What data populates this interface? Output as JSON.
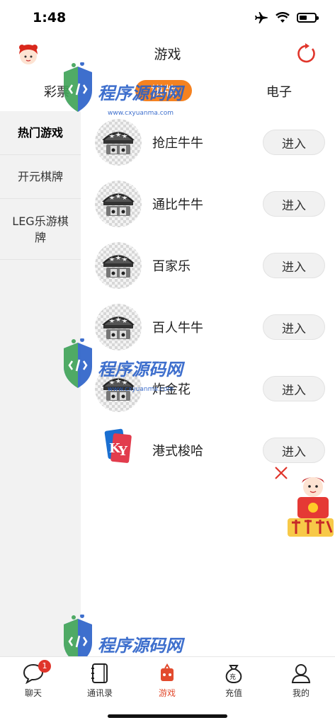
{
  "status": {
    "time": "1:48",
    "battery_level": 0.5
  },
  "nav": {
    "title": "游戏"
  },
  "top_tabs": [
    {
      "label": "彩票"
    },
    {
      "label": "棋牌",
      "active": true
    },
    {
      "label": "电子"
    }
  ],
  "side_menu": [
    {
      "label": "热门游戏",
      "active": true
    },
    {
      "label": "开元棋牌"
    },
    {
      "label": "LEG乐游棋牌"
    }
  ],
  "games": [
    {
      "name": "抢庄牛牛",
      "button": "进入",
      "icon": "casino-icon"
    },
    {
      "name": "通比牛牛",
      "button": "进入",
      "icon": "casino-icon"
    },
    {
      "name": "百家乐",
      "button": "进入",
      "icon": "casino-icon"
    },
    {
      "name": "百人牛牛",
      "button": "进入",
      "icon": "casino-icon"
    },
    {
      "name": "炸金花",
      "button": "进入",
      "icon": "casino-icon"
    },
    {
      "name": "港式梭哈",
      "button": "进入",
      "icon": "ky-cards-icon"
    }
  ],
  "watermark": {
    "text": "程序源码网",
    "url": "www.cxyuanma.com"
  },
  "bottom_tabs": [
    {
      "label": "聊天",
      "icon": "chat-icon",
      "badge": "1"
    },
    {
      "label": "通讯录",
      "icon": "contacts-icon"
    },
    {
      "label": "游戏",
      "icon": "game-icon",
      "active": true
    },
    {
      "label": "充值",
      "icon": "recharge-icon"
    },
    {
      "label": "我的",
      "icon": "profile-icon"
    }
  ],
  "colors": {
    "accent": "#f58220",
    "active_tab": "#e24b2e",
    "badge": "#e0352b",
    "watermark": "#2a60c8"
  }
}
